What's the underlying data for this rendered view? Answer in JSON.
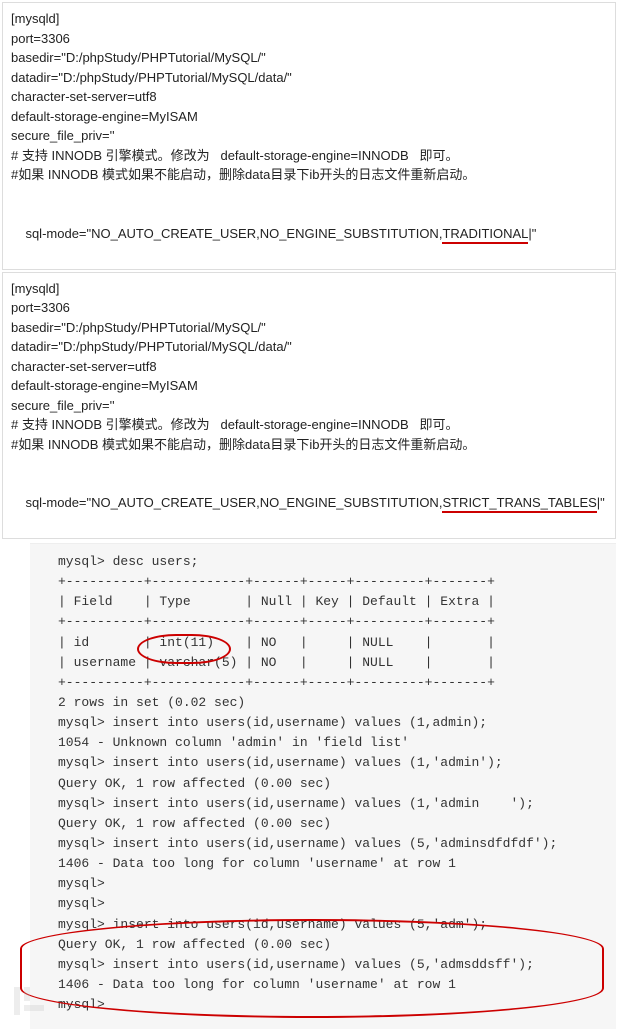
{
  "config1": {
    "lines": [
      "[mysqld]",
      "port=3306",
      "basedir=\"D:/phpStudy/PHPTutorial/MySQL/\"",
      "datadir=\"D:/phpStudy/PHPTutorial/MySQL/data/\"",
      "character-set-server=utf8",
      "default-storage-engine=MyISAM",
      "secure_file_priv=''",
      "# 支持 INNODB 引擎模式。修改为   default-storage-engine=INNODB   即可。",
      "#如果 INNODB 模式如果不能启动，删除data目录下ib开头的日志文件重新启动。"
    ],
    "sql_mode_prefix": "sql-mode=\"NO_AUTO_CREATE_USER,NO_ENGINE_SUBSTITUTION,",
    "sql_mode_highlight": "TRADITIONAL",
    "sql_mode_suffix": "|\""
  },
  "config2": {
    "lines": [
      "[mysqld]",
      "port=3306",
      "basedir=\"D:/phpStudy/PHPTutorial/MySQL/\"",
      "datadir=\"D:/phpStudy/PHPTutorial/MySQL/data/\"",
      "character-set-server=utf8",
      "default-storage-engine=MyISAM",
      "secure_file_priv=''",
      "# 支持 INNODB 引擎模式。修改为   default-storage-engine=INNODB   即可。",
      "#如果 INNODB 模式如果不能启动，删除data目录下ib开头的日志文件重新启动。"
    ],
    "sql_mode_prefix": "sql-mode=\"NO_AUTO_CREATE_USER,NO_ENGINE_SUBSTITUTION,",
    "sql_mode_highlight": "STRICT_TRANS_TABLES",
    "sql_mode_suffix": "|\""
  },
  "terminal": {
    "lines": [
      "mysql> desc users;",
      "+----------+------------+------+-----+---------+-------+",
      "| Field    | Type       | Null | Key | Default | Extra |",
      "+----------+------------+------+-----+---------+-------+",
      "| id       | int(11)    | NO   |     | NULL    |       |",
      "| username | varchar(5) | NO   |     | NULL    |       |",
      "+----------+------------+------+-----+---------+-------+",
      "2 rows in set (0.02 sec)",
      "",
      "mysql> insert into users(id,username) values (1,admin);",
      "1054 - Unknown column 'admin' in 'field list'",
      "mysql> insert into users(id,username) values (1,'admin');",
      "Query OK, 1 row affected (0.00 sec)",
      "mysql> insert into users(id,username) values (1,'admin    ');",
      "Query OK, 1 row affected (0.00 sec)",
      "mysql> insert into users(id,username) values (5,'adminsdfdfdf');",
      "1406 - Data too long for column 'username' at row 1",
      "mysql>",
      "mysql>",
      "mysql> insert into users(id,username) values (5,'adm');",
      "Query OK, 1 row affected (0.00 sec)",
      "mysql> insert into users(id,username) values (5,'admsddsff');",
      "1406 - Data too long for column 'username' at row 1",
      "mysql>"
    ]
  }
}
